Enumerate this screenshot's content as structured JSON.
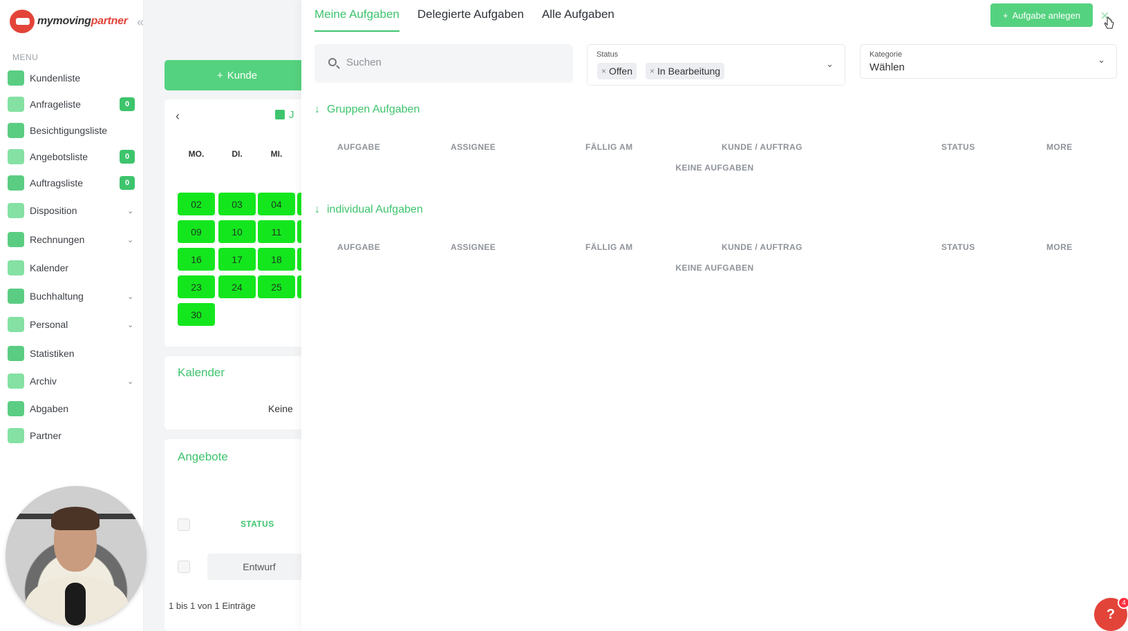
{
  "brand": {
    "logo_text_main": "mymoving",
    "logo_text_accent": "partner"
  },
  "sidebar": {
    "menu_label": "MENU",
    "items": [
      {
        "label": "Kundenliste",
        "icon": "users-icon"
      },
      {
        "label": "Anfrageliste",
        "icon": "inbox-icon",
        "badge": "0"
      },
      {
        "label": "Besichtigungsliste",
        "icon": "house-icon"
      },
      {
        "label": "Angebotsliste",
        "icon": "document-icon",
        "badge": "0"
      },
      {
        "label": "Auftragsliste",
        "icon": "file-icon",
        "badge": "0"
      },
      {
        "label": "Disposition",
        "icon": "chart-icon",
        "expandable": true
      },
      {
        "label": "Rechnungen",
        "icon": "money-icon",
        "expandable": true
      },
      {
        "label": "Kalender",
        "icon": "calendar-icon"
      },
      {
        "label": "Buchhaltung",
        "icon": "grid-icon",
        "expandable": true
      },
      {
        "label": "Personal",
        "icon": "person-icon",
        "expandable": true
      },
      {
        "label": "Statistiken",
        "icon": "stats-icon"
      },
      {
        "label": "Archiv",
        "icon": "archive-icon",
        "expandable": true
      },
      {
        "label": "Abgaben",
        "icon": "share-icon"
      },
      {
        "label": "Partner",
        "icon": "handshake-icon"
      }
    ]
  },
  "middle": {
    "kunde_button": "Kunde",
    "calendar": {
      "month_initial": "J",
      "weekdays": [
        "MO.",
        "DI.",
        "MI."
      ],
      "days": [
        "02",
        "03",
        "04",
        "09",
        "10",
        "11",
        "16",
        "17",
        "18",
        "23",
        "24",
        "25",
        "30"
      ]
    },
    "kalender_title": "Kalender",
    "kalender_empty": "Keine",
    "angebote_title": "Angebote",
    "angebote_status_header": "STATUS",
    "angebote_row_status": "Entwurf",
    "angebote_footer": "1 bis 1 von 1 Einträge"
  },
  "panel": {
    "tabs": [
      "Meine Aufgaben",
      "Delegierte Aufgaben",
      "Alle Aufgaben"
    ],
    "active_tab": 0,
    "add_button": "Aufgabe anlegen",
    "search_placeholder": "Suchen",
    "status_filter": {
      "label": "Status",
      "chips": [
        "Offen",
        "In Bearbeitung"
      ]
    },
    "kategorie_filter": {
      "label": "Kategorie",
      "value": "Wählen"
    },
    "columns": [
      "AUFGABE",
      "ASSIGNEE",
      "FÄLLIG AM",
      "KUNDE / AUFTRAG",
      "STATUS",
      "MORE"
    ],
    "sections": [
      {
        "title": "Gruppen Aufgaben",
        "empty": "KEINE AUFGABEN"
      },
      {
        "title": "individual Aufgaben",
        "empty": "KEINE AUFGABEN"
      }
    ]
  },
  "help": {
    "label": "?",
    "badge": "4"
  },
  "colors": {
    "accent": "#3ec46d",
    "button": "#55d27f",
    "day_highlight": "#14e61e",
    "brand_red": "#e3443a"
  }
}
